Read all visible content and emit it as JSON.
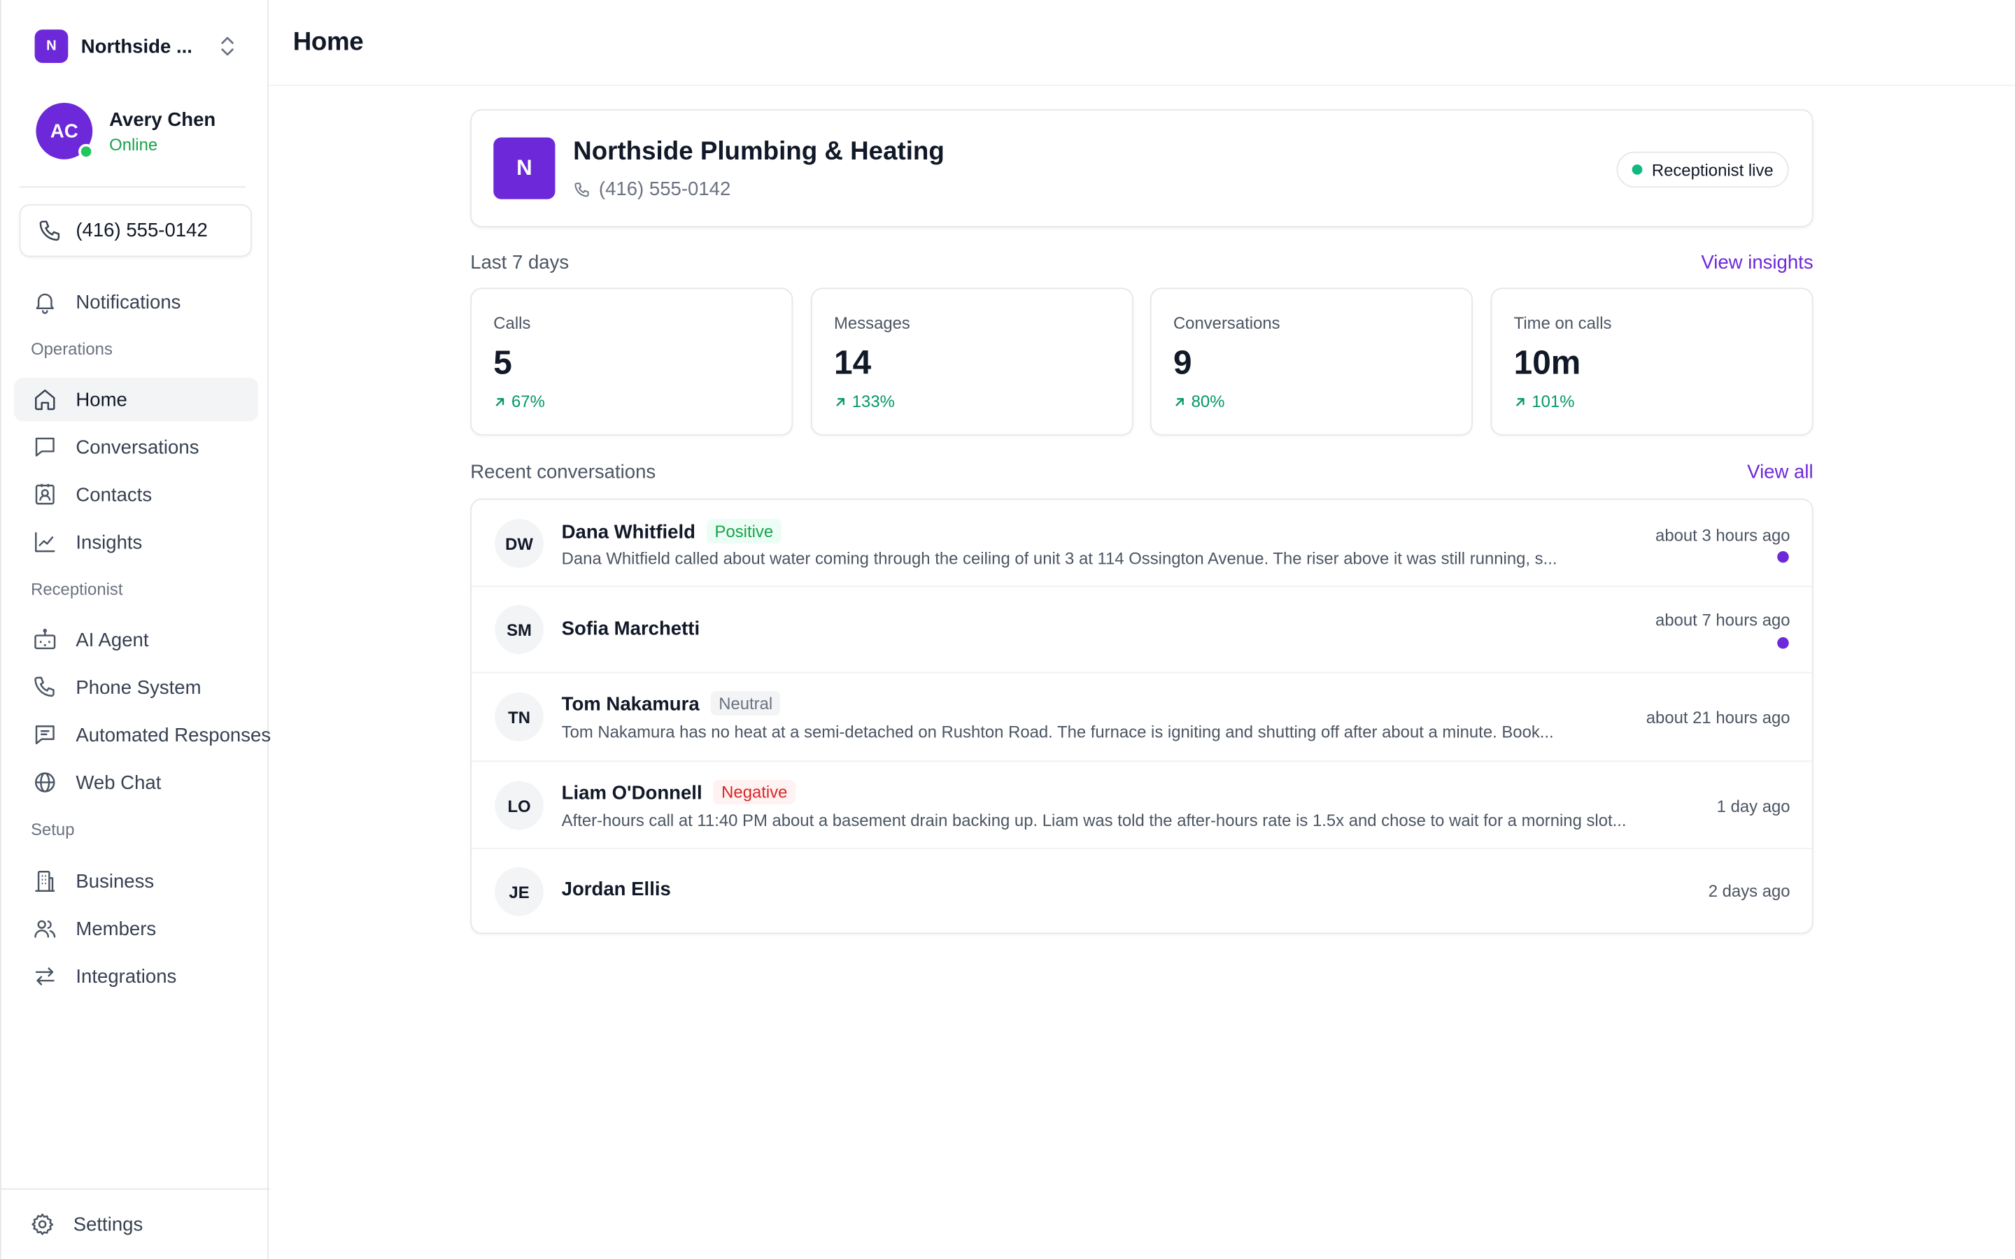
{
  "workspace": {
    "initial": "N",
    "name": "Northside ..."
  },
  "user": {
    "initials": "AC",
    "name": "Avery Chen",
    "status": "Online"
  },
  "sidebar": {
    "phone": "(416) 555-0142",
    "notifications": "Notifications",
    "sections": {
      "operations": "Operations",
      "receptionist": "Receptionist",
      "setup": "Setup"
    },
    "items": {
      "home": "Home",
      "conversations": "Conversations",
      "contacts": "Contacts",
      "insights": "Insights",
      "ai_agent": "AI Agent",
      "phone_system": "Phone System",
      "automated_responses": "Automated Responses",
      "web_chat": "Web Chat",
      "business": "Business",
      "members": "Members",
      "integrations": "Integrations"
    },
    "settings": "Settings"
  },
  "header": {
    "title": "Home"
  },
  "business": {
    "initial": "N",
    "name": "Northside Plumbing & Heating",
    "phone": "(416) 555-0142",
    "status": "Receptionist live"
  },
  "stats": {
    "title": "Last 7 days",
    "link": "View insights",
    "cards": [
      {
        "label": "Calls",
        "value": "5",
        "change": "67%"
      },
      {
        "label": "Messages",
        "value": "14",
        "change": "133%"
      },
      {
        "label": "Conversations",
        "value": "9",
        "change": "80%"
      },
      {
        "label": "Time on calls",
        "value": "10m",
        "change": "101%"
      }
    ]
  },
  "recent": {
    "title": "Recent conversations",
    "link": "View all",
    "rows": [
      {
        "initials": "DW",
        "name": "Dana Whitfield",
        "sentiment": "Positive",
        "snippet": "Dana Whitfield called about water coming through the ceiling of unit 3 at 114 Ossington Avenue. The riser above it was still running, s...",
        "time": "about 3 hours ago",
        "unread": true
      },
      {
        "initials": "SM",
        "name": "Sofia Marchetti",
        "sentiment": "",
        "snippet": "",
        "time": "about 7 hours ago",
        "unread": true
      },
      {
        "initials": "TN",
        "name": "Tom Nakamura",
        "sentiment": "Neutral",
        "snippet": "Tom Nakamura has no heat at a semi-detached on Rushton Road. The furnace is igniting and shutting off after about a minute. Book...",
        "time": "about 21 hours ago",
        "unread": false
      },
      {
        "initials": "LO",
        "name": "Liam O'Donnell",
        "sentiment": "Negative",
        "snippet": "After-hours call at 11:40 PM about a basement drain backing up. Liam was told the after-hours rate is 1.5x and chose to wait for a morning slot...",
        "time": "1 day ago",
        "unread": false
      },
      {
        "initials": "JE",
        "name": "Jordan Ellis",
        "sentiment": "",
        "snippet": "",
        "time": "2 days ago",
        "unread": false
      }
    ]
  },
  "colors": {
    "brand": "#6d28d9",
    "positive": "#16a34a",
    "negative": "#dc2626",
    "online": "#22c55e"
  }
}
